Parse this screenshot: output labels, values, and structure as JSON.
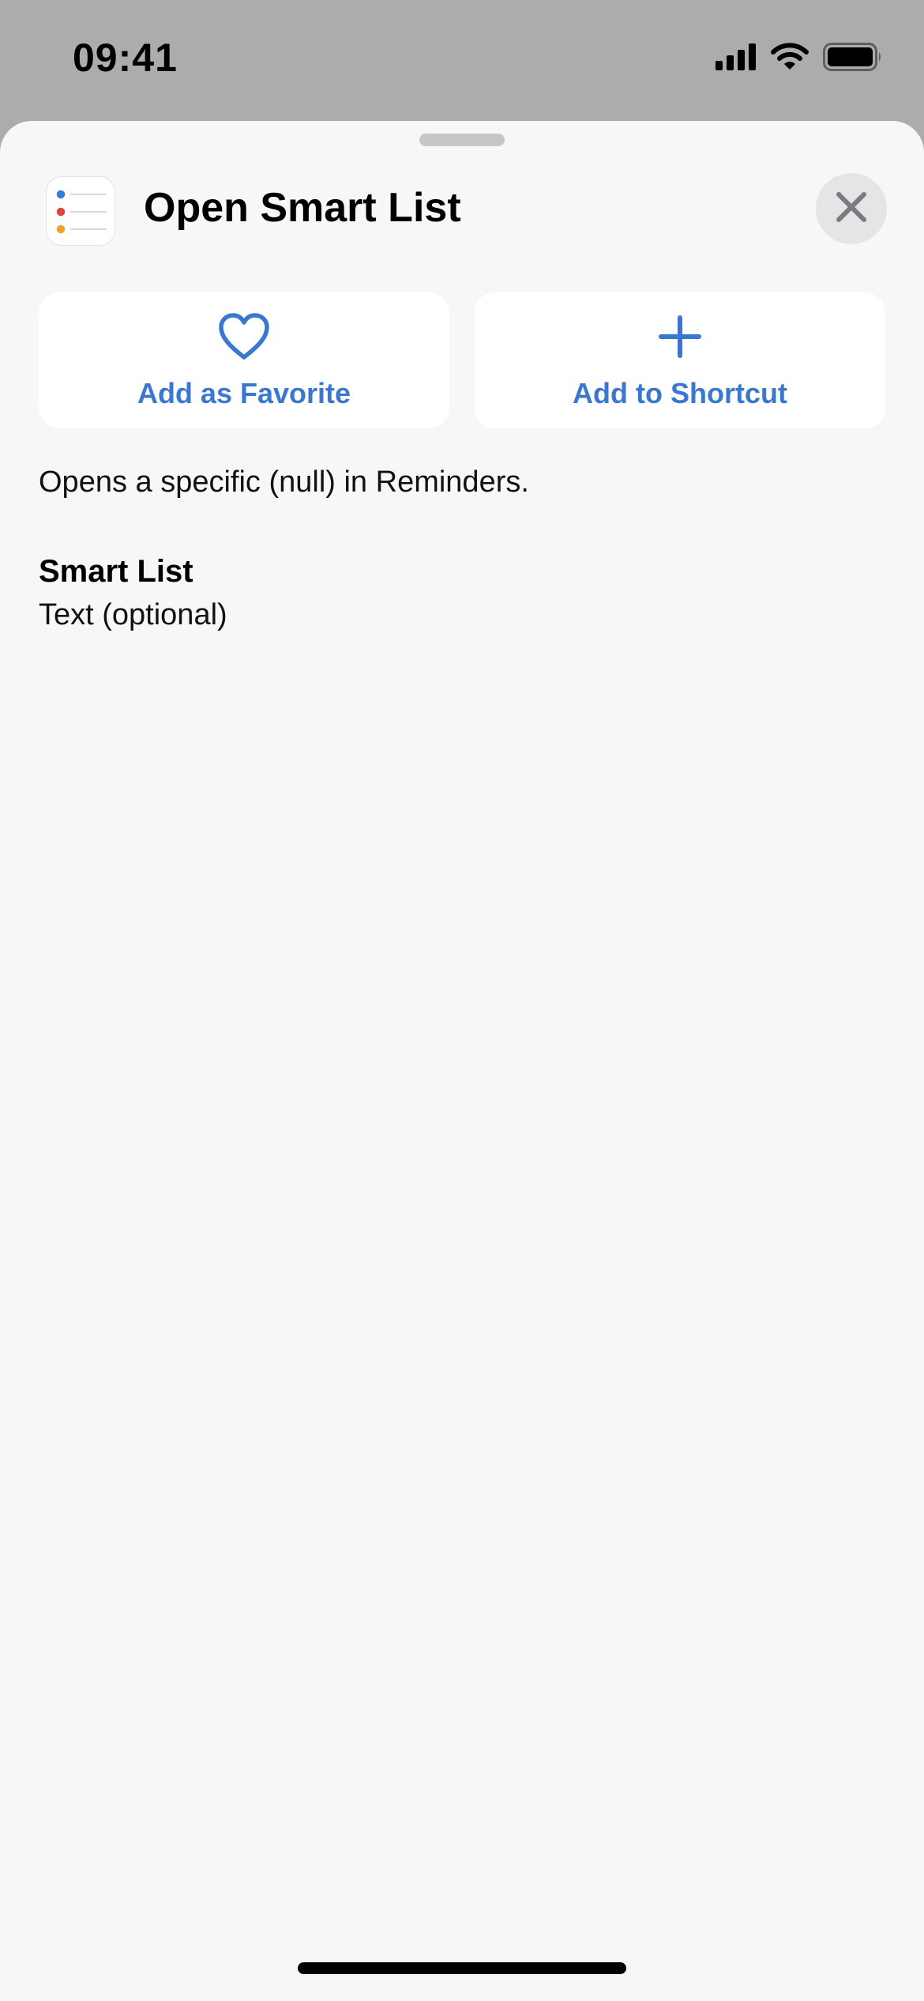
{
  "status_bar": {
    "time": "09:41",
    "icons": [
      "cellular-signal-icon",
      "wifi-icon",
      "battery-icon"
    ]
  },
  "sheet": {
    "app_icon": "reminders-app-icon",
    "title": "Open Smart List",
    "close_icon": "close-icon",
    "actions": [
      {
        "label": "Add as Favorite",
        "icon": "heart-icon"
      },
      {
        "label": "Add to Shortcut",
        "icon": "plus-icon"
      }
    ],
    "description": "Opens a specific (null) in Reminders.",
    "parameter": {
      "title": "Smart List",
      "type": "Text (optional)"
    }
  },
  "colors": {
    "accent": "#3a78d0",
    "sheet_background": "#f7f7f8",
    "backdrop": "#acacae",
    "reminder_dots": [
      "#3a7bd5",
      "#e0463c",
      "#eba42d"
    ]
  }
}
